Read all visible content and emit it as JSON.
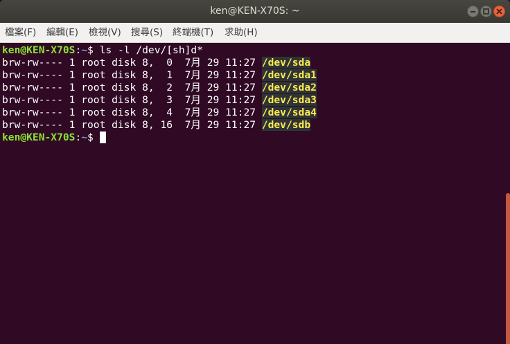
{
  "window": {
    "title": "ken@KEN-X70S: ~"
  },
  "menubar": {
    "items": [
      {
        "label": "檔案(F)"
      },
      {
        "label": "編輯(E)"
      },
      {
        "label": "檢視(V)"
      },
      {
        "label": "搜尋(S)"
      },
      {
        "label": "終端機(T)"
      },
      {
        "label": "求助(H)"
      }
    ]
  },
  "terminal": {
    "prompt_user": "ken@KEN-X70S",
    "prompt_sep": ":",
    "prompt_path": "~",
    "prompt_symbol": "$",
    "command": " ls -l /dev/[sh]d*",
    "rows": [
      {
        "meta": "brw-rw---- 1 root disk 8,  0  7月 29 11:27 ",
        "name": "/dev/sda"
      },
      {
        "meta": "brw-rw---- 1 root disk 8,  1  7月 29 11:27 ",
        "name": "/dev/sda1"
      },
      {
        "meta": "brw-rw---- 1 root disk 8,  2  7月 29 11:27 ",
        "name": "/dev/sda2"
      },
      {
        "meta": "brw-rw---- 1 root disk 8,  3  7月 29 11:27 ",
        "name": "/dev/sda3"
      },
      {
        "meta": "brw-rw---- 1 root disk 8,  4  7月 29 11:27 ",
        "name": "/dev/sda4"
      },
      {
        "meta": "brw-rw---- 1 root disk 8, 16  7月 29 11:27 ",
        "name": "/dev/sdb"
      }
    ]
  },
  "colors": {
    "terminal_bg": "#300a24",
    "prompt_user": "#8ae234",
    "prompt_path": "#729fcf",
    "device_name": "#fce94f",
    "device_bg": "#2e3436",
    "close_button": "#e8643a",
    "scrollbar_thumb": "#c35a3e"
  },
  "icons": {
    "close": "close-icon",
    "maximize": "maximize-icon",
    "minimize": "minimize-icon"
  }
}
